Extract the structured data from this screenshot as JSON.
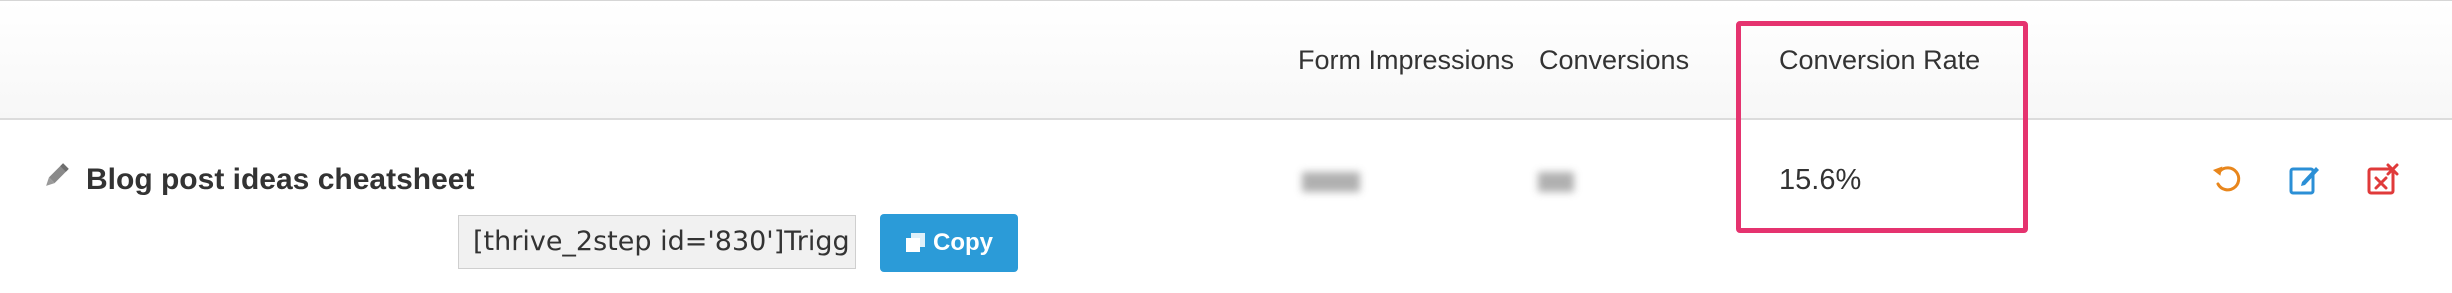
{
  "table": {
    "headers": {
      "impressions": "Form Impressions",
      "conversions": "Conversions",
      "rate": "Conversion Rate"
    },
    "row": {
      "title": "Blog post ideas cheatsheet",
      "shortcode": "[thrive_2step id='830']Trigg",
      "copy_label": "Copy",
      "conversion_rate": "15.6%",
      "impressions_blurred": true,
      "conversions_blurred": true
    },
    "actions": [
      "reset-stats-icon",
      "edit-icon",
      "delete-icon"
    ]
  },
  "colors": {
    "highlight": "#e5336f",
    "copy_button": "#2b9bd8",
    "reset_icon": "#e8861c",
    "edit_icon": "#2b8fd6",
    "delete_icon": "#e03a3a"
  }
}
